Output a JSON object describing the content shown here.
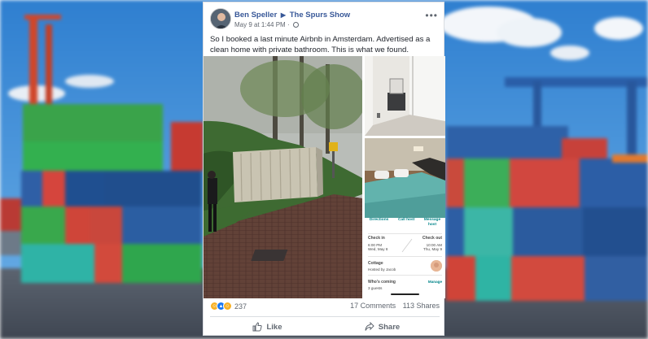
{
  "post": {
    "author": "Ben Speller",
    "group": "The Spurs Show",
    "timestamp": "May 9 at 1:44 PM",
    "text": "So I booked a last minute Airbnb in Amsterdam. Advertised as a clean home with private bathroom. This is what we found.",
    "more_label": "•••"
  },
  "airbnb": {
    "directions": "Directions",
    "host": "Call host",
    "message_line1": "Message",
    "message_line2": "host",
    "checkin_label": "Check in",
    "checkin_time": "6:00 PM",
    "checkin_date": "Wed, May 8",
    "checkout_label": "Check out",
    "checkout_time": "10:00 AM",
    "checkout_date": "Thu, May 9",
    "cottage_title": "Cottage",
    "hosted_by": "Hosted by Jacob",
    "whos_coming": "Who's coming",
    "manage": "Manage",
    "guests": "3 guests"
  },
  "stats": {
    "reaction_count": "237",
    "comments": "17 Comments",
    "shares": "113 Shares"
  },
  "actions": {
    "like": "Like",
    "share": "Share"
  },
  "colors": {
    "link_blue": "#385898",
    "airbnb_teal": "#008489",
    "like_blue": "#1877f2",
    "love_red": "#f33e58",
    "haha_yellow": "#f7b125"
  }
}
